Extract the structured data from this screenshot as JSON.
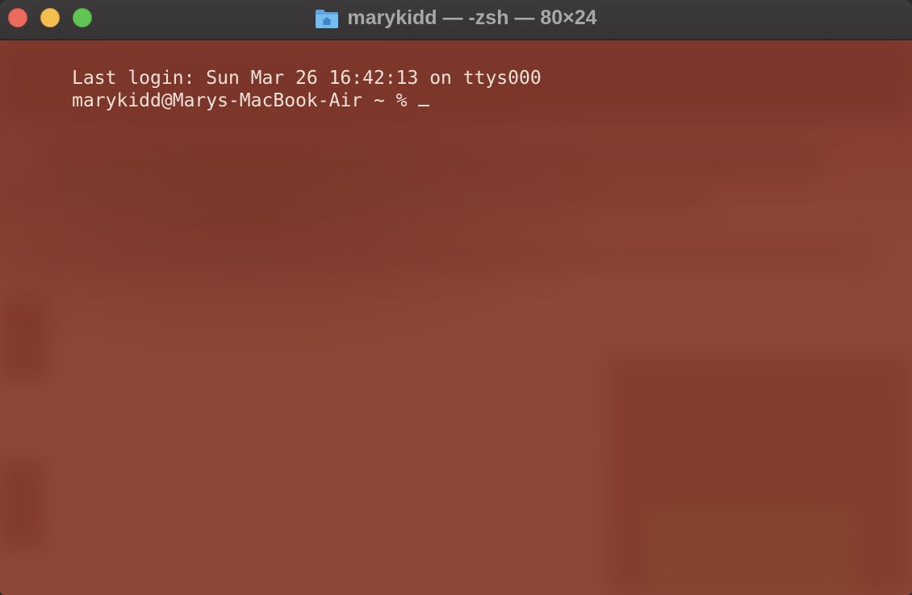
{
  "window": {
    "title": "marykidd — -zsh — 80×24",
    "title_icon": "home-folder-icon",
    "controls": [
      "close",
      "minimize",
      "zoom"
    ]
  },
  "colors": {
    "terminal_background": "#8a4536",
    "terminal_text": "#f1e2d8",
    "titlebar": "#383637",
    "close": "#ed6a5e",
    "minimize": "#f5bf4f",
    "zoom": "#61c554"
  },
  "terminal": {
    "lines": [
      "Last login: Sun Mar 26 16:42:13 on ttys000",
      "marykidd@Marys-MacBook-Air ~ %"
    ]
  }
}
